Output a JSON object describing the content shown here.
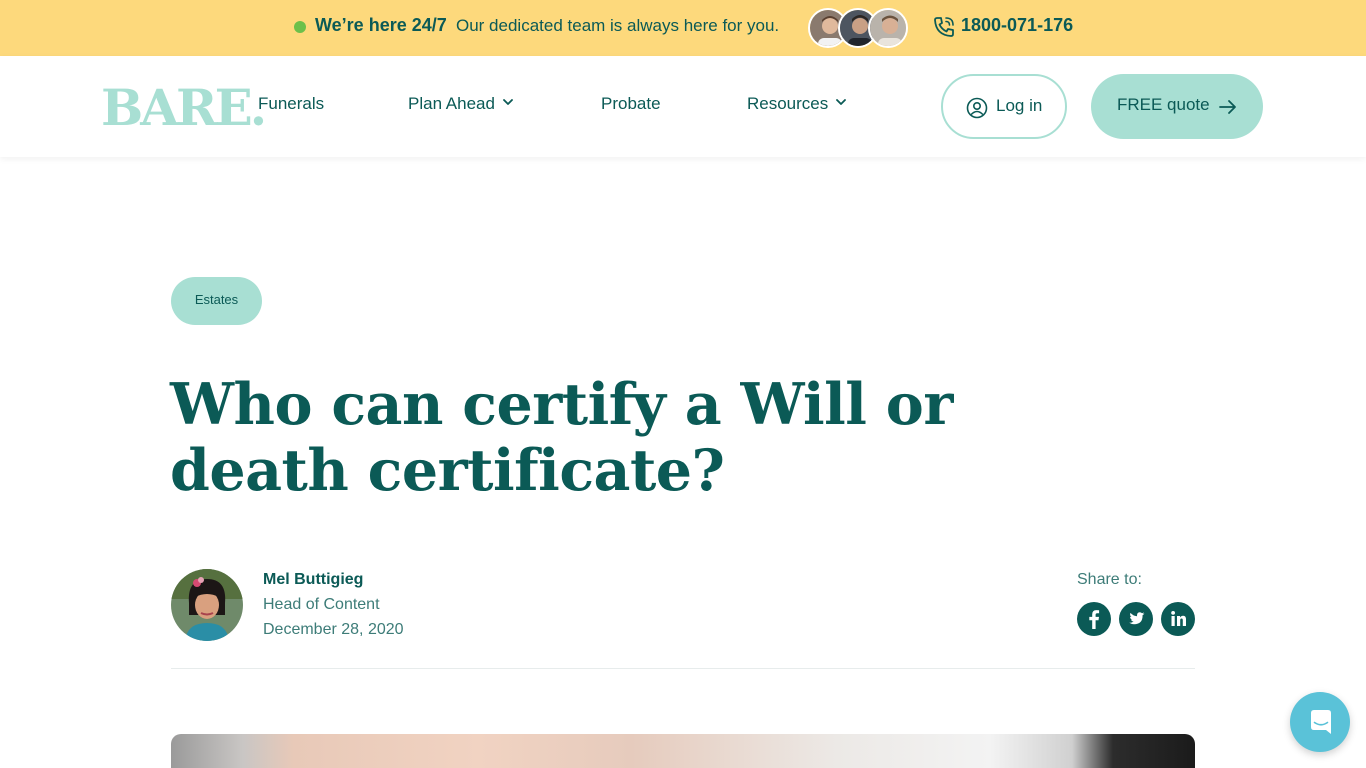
{
  "topbar": {
    "highlight": "We’re here 24/7",
    "message": "Our dedicated team is always here for you.",
    "phone": "1800-071-176"
  },
  "header": {
    "logo": "BARE.",
    "nav": [
      {
        "label": "Funerals",
        "has_dropdown": false
      },
      {
        "label": "Plan Ahead",
        "has_dropdown": true
      },
      {
        "label": "Probate",
        "has_dropdown": false
      },
      {
        "label": "Resources",
        "has_dropdown": true
      }
    ],
    "login_label": "Log in",
    "quote_label": "FREE quote"
  },
  "article": {
    "tag": "Estates",
    "title": "Who can certify a Will or death certificate?",
    "author": {
      "name": "Mel Buttigieg",
      "role": "Head of Content",
      "date": "December 28, 2020"
    },
    "share_label": "Share to:",
    "share_icons": [
      "facebook-icon",
      "twitter-icon",
      "linkedin-icon"
    ]
  },
  "colors": {
    "topbar_bg": "#fdd97c",
    "brand_dark": "#0b5a56",
    "brand_mint": "#a8dfd3",
    "online_dot": "#6cc04a",
    "chat_bg": "#5ac2d8"
  }
}
